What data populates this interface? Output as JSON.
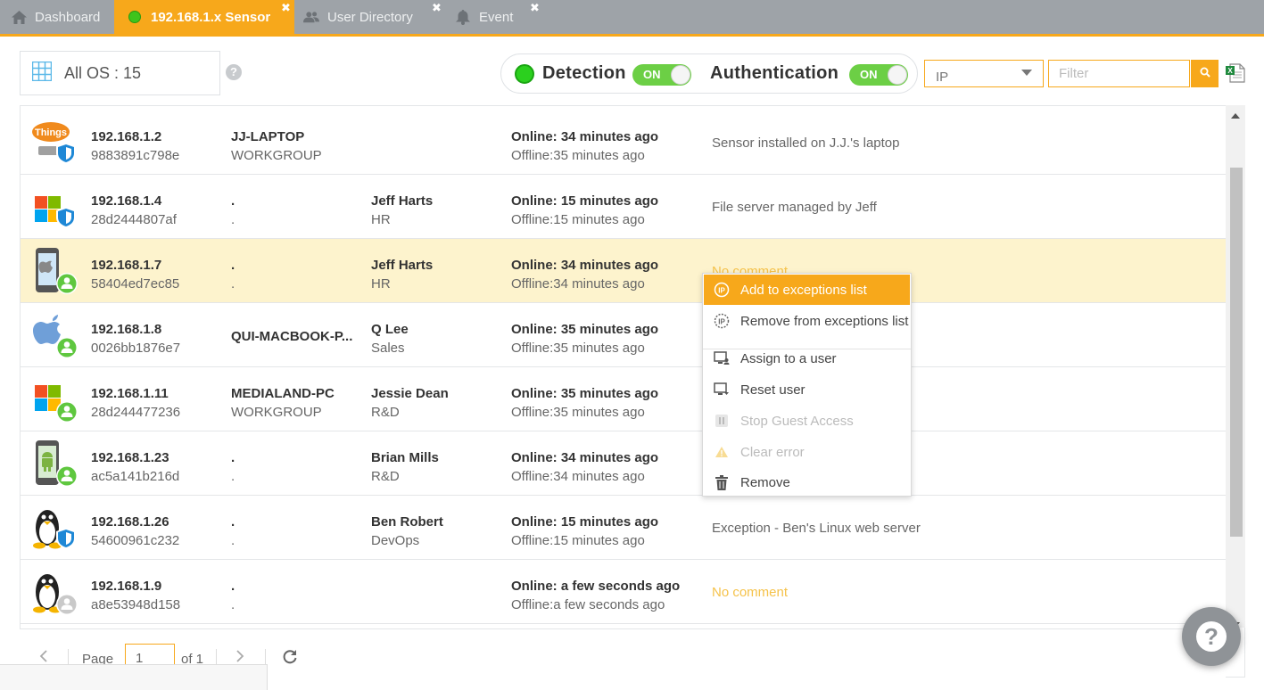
{
  "tabs": [
    {
      "label": "Dashboard",
      "icon": "home-icon",
      "closable": false
    },
    {
      "label": "192.168.1.x Sensor",
      "icon": "status-dot-icon",
      "closable": true,
      "active": true
    },
    {
      "label": "User Directory",
      "icon": "users-icon",
      "closable": true
    },
    {
      "label": "Event",
      "icon": "bell-icon",
      "closable": true
    }
  ],
  "close_glyph": "✖",
  "os_filter": {
    "label": "All OS : 15",
    "help": "?"
  },
  "toggles": {
    "detection": {
      "label": "Detection",
      "state": "ON"
    },
    "authentication": {
      "label": "Authentication",
      "state": "ON"
    }
  },
  "search": {
    "field": "IP",
    "placeholder": "Filter"
  },
  "rows": [
    {
      "ip": "192.168.1.2",
      "mac": "9883891c798e",
      "host": "JJ-LAPTOP",
      "group": "WORKGROUP",
      "user": "",
      "dept": "",
      "online": "Online: 34 minutes ago",
      "offline": "Offline:35 minutes ago",
      "comment": "Sensor installed on J.J.'s laptop",
      "icon": "things-shield-icon"
    },
    {
      "ip": "192.168.1.4",
      "mac": "28d2444807af",
      "host": ".",
      "group": ".",
      "user": "Jeff Harts",
      "dept": "HR",
      "online": "Online: 15 minutes ago",
      "offline": "Offline:15 minutes ago",
      "comment": "File server managed by Jeff",
      "icon": "windows-shield-icon"
    },
    {
      "ip": "192.168.1.7",
      "mac": "58404ed7ec85",
      "host": ".",
      "group": ".",
      "user": "Jeff Harts",
      "dept": "HR",
      "online": "Online: 34 minutes ago",
      "offline": "Offline:34 minutes ago",
      "comment": "No comment",
      "icon": "iphone-user-icon"
    },
    {
      "ip": "192.168.1.8",
      "mac": "0026bb1876e7",
      "host": "QUI-MACBOOK-P...",
      "group": "",
      "user": "Q Lee",
      "dept": "Sales",
      "online": "Online: 35 minutes ago",
      "offline": "Offline:35 minutes ago",
      "comment": "",
      "icon": "apple-user-icon"
    },
    {
      "ip": "192.168.1.11",
      "mac": "28d244477236",
      "host": "MEDIALAND-PC",
      "group": "WORKGROUP",
      "user": "Jessie Dean",
      "dept": "R&D",
      "online": "Online: 35 minutes ago",
      "offline": "Offline:35 minutes ago",
      "comment": "",
      "icon": "windows-user-icon"
    },
    {
      "ip": "192.168.1.23",
      "mac": "ac5a141b216d",
      "host": ".",
      "group": ".",
      "user": "Brian Mills",
      "dept": "R&D",
      "online": "Online: 34 minutes ago",
      "offline": "Offline:34 minutes ago",
      "comment": "",
      "icon": "android-user-icon"
    },
    {
      "ip": "192.168.1.26",
      "mac": "54600961c232",
      "host": ".",
      "group": ".",
      "user": "Ben Robert",
      "dept": "DevOps",
      "online": "Online: 15 minutes ago",
      "offline": "Offline:15 minutes ago",
      "comment": "Exception - Ben's Linux web server",
      "icon": "linux-shield-icon"
    },
    {
      "ip": "192.168.1.9",
      "mac": "a8e53948d158",
      "host": ".",
      "group": ".",
      "user": "",
      "dept": "",
      "online": "Online: a few seconds ago",
      "offline": "Offline:a few seconds ago",
      "comment": "No comment",
      "icon": "linux-user-icon"
    }
  ],
  "context_menu": [
    {
      "label": "Add to exceptions list",
      "icon": "ip-exception-icon",
      "highlighted": true
    },
    {
      "label": "Remove from exceptions list",
      "icon": "ip-remove-icon"
    },
    {
      "label": "Assign to a user",
      "icon": "monitor-user-icon"
    },
    {
      "label": "Reset user",
      "icon": "monitor-reset-icon"
    },
    {
      "label": "Stop Guest Access",
      "icon": "pause-icon",
      "disabled": true
    },
    {
      "label": "Clear error",
      "icon": "warning-icon",
      "disabled": true
    },
    {
      "label": "Remove",
      "icon": "trash-icon"
    }
  ],
  "pager": {
    "page_label": "Page",
    "page_value": "1",
    "of_label": "of 1"
  },
  "help_fab": "?",
  "colors": {
    "accent": "#f7a81b",
    "tabbar": "#9ea3a8",
    "toggle_on": "#6ccf45",
    "selected_row": "#fdf3cd",
    "no_comment": "#f5c24a"
  }
}
